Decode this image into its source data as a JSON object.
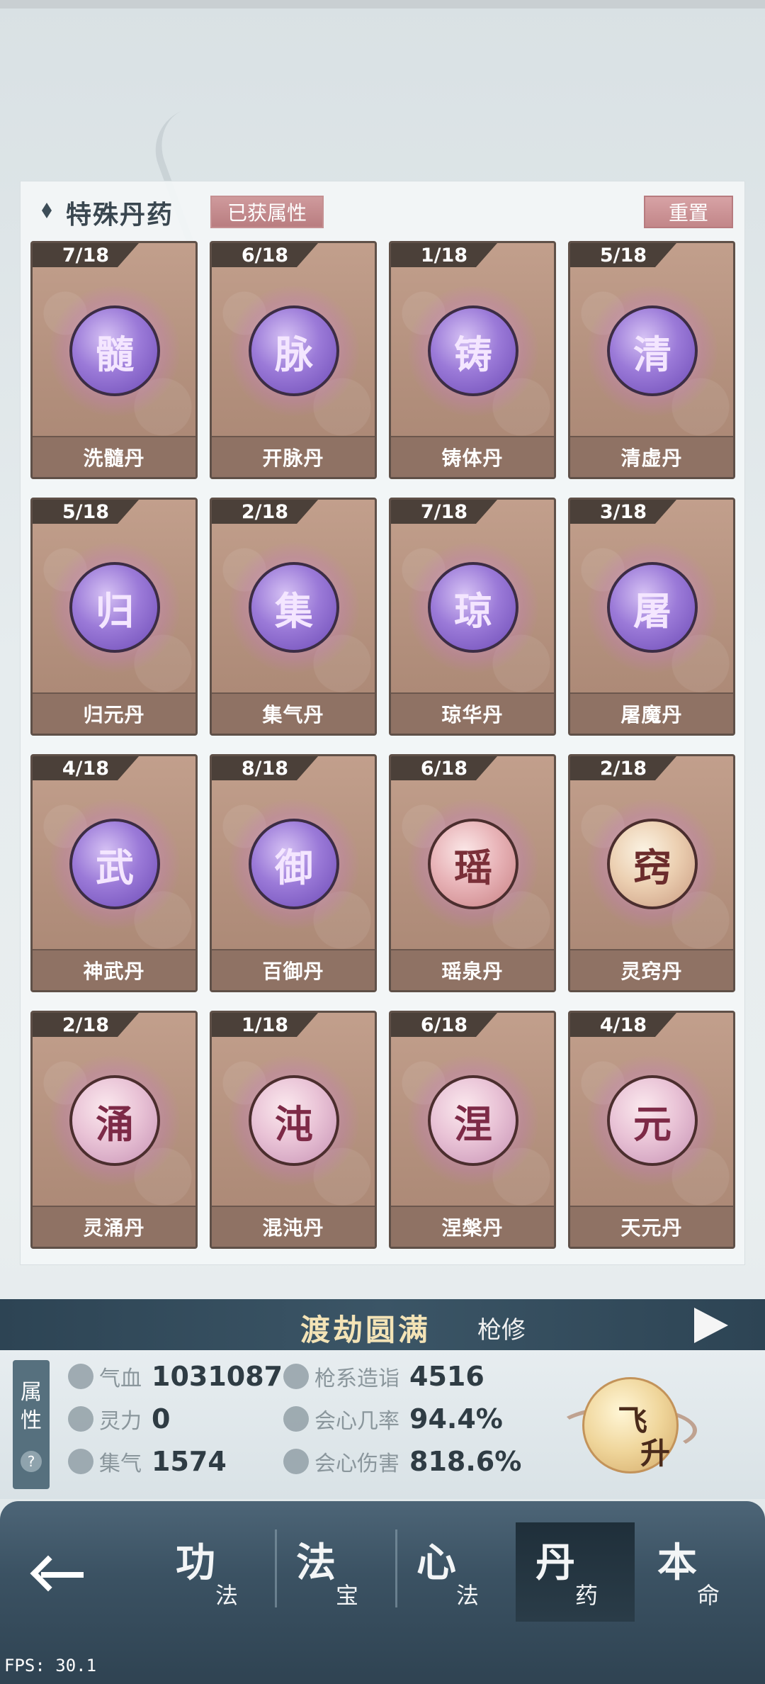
{
  "panel": {
    "title": "特殊丹药",
    "attr_tag": "已获属性",
    "reset_label": "重置"
  },
  "pills": [
    {
      "count": "7/18",
      "glyph": "髓",
      "name": "洗髓丹",
      "color": "purple"
    },
    {
      "count": "6/18",
      "glyph": "脉",
      "name": "开脉丹",
      "color": "purple"
    },
    {
      "count": "1/18",
      "glyph": "铸",
      "name": "铸体丹",
      "color": "purple"
    },
    {
      "count": "5/18",
      "glyph": "清",
      "name": "清虚丹",
      "color": "purple"
    },
    {
      "count": "5/18",
      "glyph": "归",
      "name": "归元丹",
      "color": "purple"
    },
    {
      "count": "2/18",
      "glyph": "集",
      "name": "集气丹",
      "color": "purple"
    },
    {
      "count": "7/18",
      "glyph": "琼",
      "name": "琼华丹",
      "color": "purple"
    },
    {
      "count": "3/18",
      "glyph": "屠",
      "name": "屠魔丹",
      "color": "purple"
    },
    {
      "count": "4/18",
      "glyph": "武",
      "name": "神武丹",
      "color": "purple"
    },
    {
      "count": "8/18",
      "glyph": "御",
      "name": "百御丹",
      "color": "purple"
    },
    {
      "count": "6/18",
      "glyph": "瑶",
      "name": "瑶泉丹",
      "color": "pink"
    },
    {
      "count": "2/18",
      "glyph": "窍",
      "name": "灵窍丹",
      "color": "gold"
    },
    {
      "count": "2/18",
      "glyph": "涌",
      "name": "灵涌丹",
      "color": "rose"
    },
    {
      "count": "1/18",
      "glyph": "沌",
      "name": "混沌丹",
      "color": "rose"
    },
    {
      "count": "6/18",
      "glyph": "涅",
      "name": "涅槃丹",
      "color": "rose"
    },
    {
      "count": "4/18",
      "glyph": "元",
      "name": "天元丹",
      "color": "rose"
    }
  ],
  "realm": {
    "title": "渡劫圆满",
    "subtitle": "枪修"
  },
  "attributes": {
    "side_label_1": "属",
    "side_label_2": "性",
    "help": "?",
    "stats": [
      {
        "icon": "heart-icon",
        "label": "气血",
        "value": "1031087"
      },
      {
        "icon": "spirit-flame-icon",
        "label": "灵力",
        "value": "0"
      },
      {
        "icon": "swirl-icon",
        "label": "集气",
        "value": "1574"
      },
      {
        "icon": "spear-icon",
        "label": "枪系造诣",
        "value": "4516"
      },
      {
        "icon": "crit-chance-icon",
        "label": "会心几率",
        "value": "94.4%"
      },
      {
        "icon": "crit-damage-icon",
        "label": "会心伤害",
        "value": "818.6%"
      }
    ],
    "ascend_1": "飞",
    "ascend_2": "升"
  },
  "nav": {
    "tabs": [
      {
        "big": "功",
        "small": "法"
      },
      {
        "big": "法",
        "small": "宝"
      },
      {
        "big": "心",
        "small": "法"
      },
      {
        "big": "丹",
        "small": "药"
      },
      {
        "big": "本",
        "small": "命"
      }
    ]
  },
  "fps": "FPS: 30.1"
}
